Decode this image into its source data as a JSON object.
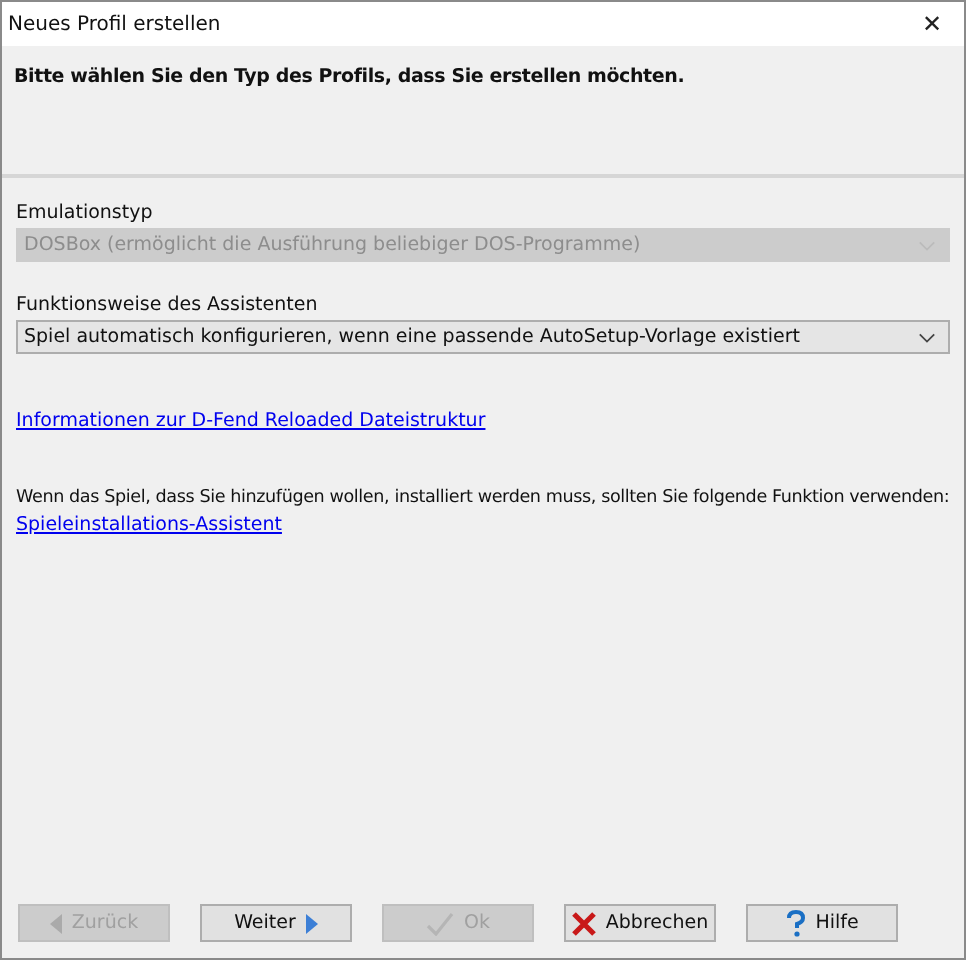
{
  "window": {
    "title": "Neues Profil erstellen",
    "close": "✕"
  },
  "header": "Bitte wählen Sie den Typ des Profils, dass Sie erstellen möchten.",
  "fields": [
    {
      "label": "Emulationstyp",
      "value": "DOSBox (ermöglicht die Ausführung beliebiger DOS-Programme)",
      "disabled": true
    },
    {
      "label": "Funktionsweise des Assistenten",
      "value": "Spiel automatisch konfigurieren, wenn eine passende AutoSetup-Vorlage existiert",
      "disabled": false
    }
  ],
  "info_link": "Informationen zur D-Fend Reloaded Dateistruktur",
  "install_text": "Wenn das Spiel, dass Sie hinzufügen wollen, installiert werden muss, sollten Sie folgende Funktion verwenden:",
  "install_link": "Spieleinstallations-Assistent",
  "buttons": [
    {
      "label": "Zurück",
      "kind": "back",
      "disabled": true
    },
    {
      "label": "Weiter",
      "kind": "next",
      "disabled": false
    },
    {
      "label": "Ok",
      "kind": "ok",
      "disabled": true
    },
    {
      "label": "Abbrechen",
      "kind": "cancel",
      "disabled": false
    },
    {
      "label": "Hilfe",
      "kind": "help",
      "disabled": false
    }
  ]
}
